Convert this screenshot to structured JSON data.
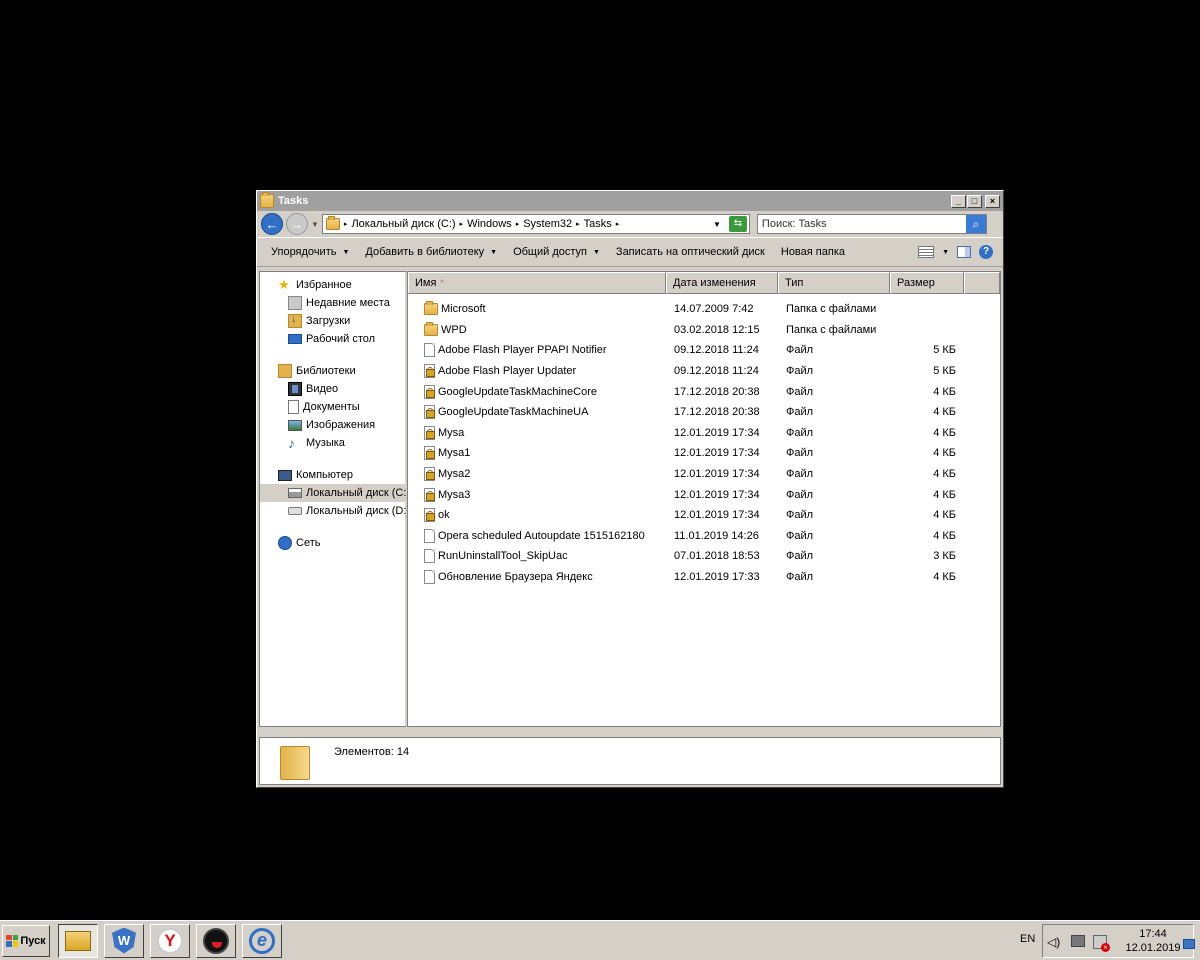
{
  "window": {
    "title": "Tasks",
    "address": {
      "crumbs": [
        "Локальный диск (C:)",
        "Windows",
        "System32",
        "Tasks"
      ]
    },
    "search": {
      "placeholder": "Поиск: Tasks"
    }
  },
  "toolbar": {
    "organize": "Упорядочить",
    "add_to_library": "Добавить в библиотеку",
    "share": "Общий доступ",
    "burn": "Записать на оптический диск",
    "new_folder": "Новая папка"
  },
  "navigation": {
    "favorites": {
      "label": "Избранное",
      "items": [
        {
          "label": "Недавние места",
          "icon": "recent-places-icon"
        },
        {
          "label": "Загрузки",
          "icon": "downloads-icon"
        },
        {
          "label": "Рабочий стол",
          "icon": "desktop-icon"
        }
      ]
    },
    "libraries": {
      "label": "Библиотеки",
      "items": [
        {
          "label": "Видео",
          "icon": "video-icon"
        },
        {
          "label": "Документы",
          "icon": "documents-icon"
        },
        {
          "label": "Изображения",
          "icon": "images-icon"
        },
        {
          "label": "Музыка",
          "icon": "music-icon"
        }
      ]
    },
    "computer": {
      "label": "Компьютер",
      "items": [
        {
          "label": "Локальный диск (C:)",
          "icon": "drive-c-icon",
          "selected": true
        },
        {
          "label": "Локальный диск (D:)",
          "icon": "drive-d-icon"
        }
      ]
    },
    "network": {
      "label": "Сеть"
    }
  },
  "columns": {
    "name": "Имя",
    "date": "Дата изменения",
    "type": "Тип",
    "size": "Размер"
  },
  "files": [
    {
      "name": "Microsoft",
      "date": "14.07.2009 7:42",
      "type": "Папка с файлами",
      "size": "",
      "icon": "folder"
    },
    {
      "name": "WPD",
      "date": "03.02.2018 12:15",
      "type": "Папка с файлами",
      "size": "",
      "icon": "folder"
    },
    {
      "name": "Adobe Flash Player PPAPI Notifier",
      "date": "09.12.2018 11:24",
      "type": "Файл",
      "size": "5 КБ",
      "icon": "file"
    },
    {
      "name": "Adobe Flash Player Updater",
      "date": "09.12.2018 11:24",
      "type": "Файл",
      "size": "5 КБ",
      "icon": "locked-file"
    },
    {
      "name": "GoogleUpdateTaskMachineCore",
      "date": "17.12.2018 20:38",
      "type": "Файл",
      "size": "4 КБ",
      "icon": "locked-file"
    },
    {
      "name": "GoogleUpdateTaskMachineUA",
      "date": "17.12.2018 20:38",
      "type": "Файл",
      "size": "4 КБ",
      "icon": "locked-file"
    },
    {
      "name": "Mysa",
      "date": "12.01.2019 17:34",
      "type": "Файл",
      "size": "4 КБ",
      "icon": "locked-file"
    },
    {
      "name": "Mysa1",
      "date": "12.01.2019 17:34",
      "type": "Файл",
      "size": "4 КБ",
      "icon": "locked-file"
    },
    {
      "name": "Mysa2",
      "date": "12.01.2019 17:34",
      "type": "Файл",
      "size": "4 КБ",
      "icon": "locked-file"
    },
    {
      "name": "Mysa3",
      "date": "12.01.2019 17:34",
      "type": "Файл",
      "size": "4 КБ",
      "icon": "locked-file"
    },
    {
      "name": "ok",
      "date": "12.01.2019 17:34",
      "type": "Файл",
      "size": "4 КБ",
      "icon": "locked-file"
    },
    {
      "name": "Opera scheduled Autoupdate 1515162180",
      "date": "11.01.2019 14:26",
      "type": "Файл",
      "size": "4 КБ",
      "icon": "file"
    },
    {
      "name": "RunUninstallTool_SkipUac",
      "date": "07.01.2018 18:53",
      "type": "Файл",
      "size": "3 КБ",
      "icon": "file"
    },
    {
      "name": "Обновление Браузера Яндекс",
      "date": "12.01.2019 17:33",
      "type": "Файл",
      "size": "4 КБ",
      "icon": "file"
    }
  ],
  "details": {
    "count_text": "Элементов: 14"
  },
  "taskbar": {
    "start_label": "Пуск",
    "pinned": [
      {
        "name": "explorer",
        "icon": "explorer-icon",
        "active": true
      },
      {
        "name": "wise-care",
        "icon": "wise-care-icon"
      },
      {
        "name": "yandex-browser",
        "icon": "yandex-icon",
        "glyph": "Y"
      },
      {
        "name": "avast",
        "icon": "avast-icon"
      },
      {
        "name": "internet-explorer",
        "icon": "ie-icon",
        "glyph": "e"
      }
    ],
    "lang": "EN",
    "time": "17:44",
    "date": "12.01.2019"
  }
}
